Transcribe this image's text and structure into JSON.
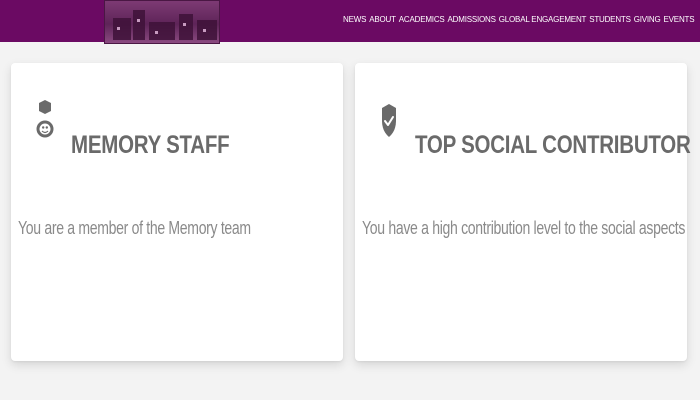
{
  "header": {
    "brand_color": "#6b0a63",
    "nav": [
      "NEWS",
      "ABOUT",
      "ACADEMICS",
      "ADMISSIONS",
      "GLOBAL ENGAGEMENT",
      "STUDENTS",
      "GIVING",
      "EVENTS"
    ]
  },
  "cards": [
    {
      "icon": "memory-badge-icon",
      "title": "MEMORY STAFF",
      "description": "You are a member of the Memory team"
    },
    {
      "icon": "shield-check-icon",
      "title": "TOP SOCIAL CONTRIBUTOR",
      "description": "You have a high contribution level to the social aspects"
    }
  ]
}
